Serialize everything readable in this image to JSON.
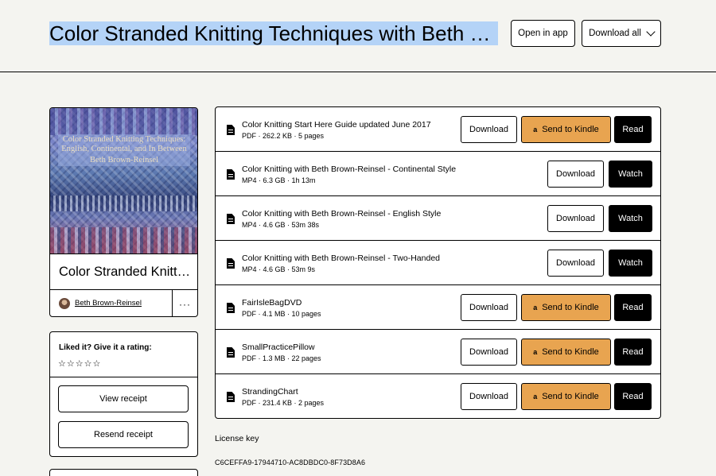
{
  "header": {
    "title": "Color Stranded Knitting Techniques with Beth Brown-Reinsel",
    "open_app_label": "Open in app",
    "download_all_label": "Download all"
  },
  "product": {
    "cover_title": "Color Stranded Knitting Techniques: English, Continental, and In Between",
    "cover_author": "Beth Brown-Reinsel",
    "name": "Color Stranded Knitting Techniques with Beth Brown-Reinsel",
    "creator": "Beth Brown-Reinsel",
    "more_label": "···"
  },
  "rating": {
    "title": "Liked it? Give it a rating:",
    "stars": "☆☆☆☆☆",
    "view_receipt_label": "View receipt",
    "resend_receipt_label": "Resend receipt"
  },
  "files": [
    {
      "name": "Color Knitting Start Here Guide updated June 2017",
      "meta": "PDF · 262.2 KB · 5 pages",
      "download": "Download",
      "kindle": "Send to Kindle",
      "action": "Read"
    },
    {
      "name": "Color Knitting with Beth Brown-Reinsel - Continental Style",
      "meta": "MP4 · 6.3 GB · 1h 13m",
      "download": "Download",
      "action": "Watch"
    },
    {
      "name": "Color Knitting with Beth Brown-Reinsel - English Style",
      "meta": "MP4 · 4.6 GB · 53m 38s",
      "download": "Download",
      "action": "Watch"
    },
    {
      "name": "Color Knitting with Beth Brown-Reinsel - Two-Handed",
      "meta": "MP4 · 4.6 GB · 53m 9s",
      "download": "Download",
      "action": "Watch"
    },
    {
      "name": "FairIsleBagDVD",
      "meta": "PDF · 4.1 MB · 10 pages",
      "download": "Download",
      "kindle": "Send to Kindle",
      "action": "Read"
    },
    {
      "name": "SmallPracticePillow",
      "meta": "PDF · 1.3 MB · 22 pages",
      "download": "Download",
      "kindle": "Send to Kindle",
      "action": "Read"
    },
    {
      "name": "StrandingChart",
      "meta": "PDF · 231.4 KB · 2 pages",
      "download": "Download",
      "kindle": "Send to Kindle",
      "action": "Read"
    }
  ],
  "license": {
    "label": "License key",
    "key": "C6CEFFA9-17944710-AC8DBDC0-8F73D8A6"
  },
  "colors": {
    "background": "#f4f4f0",
    "kindle_button": "#e8a450",
    "selection_highlight": "#b4d3f7"
  }
}
